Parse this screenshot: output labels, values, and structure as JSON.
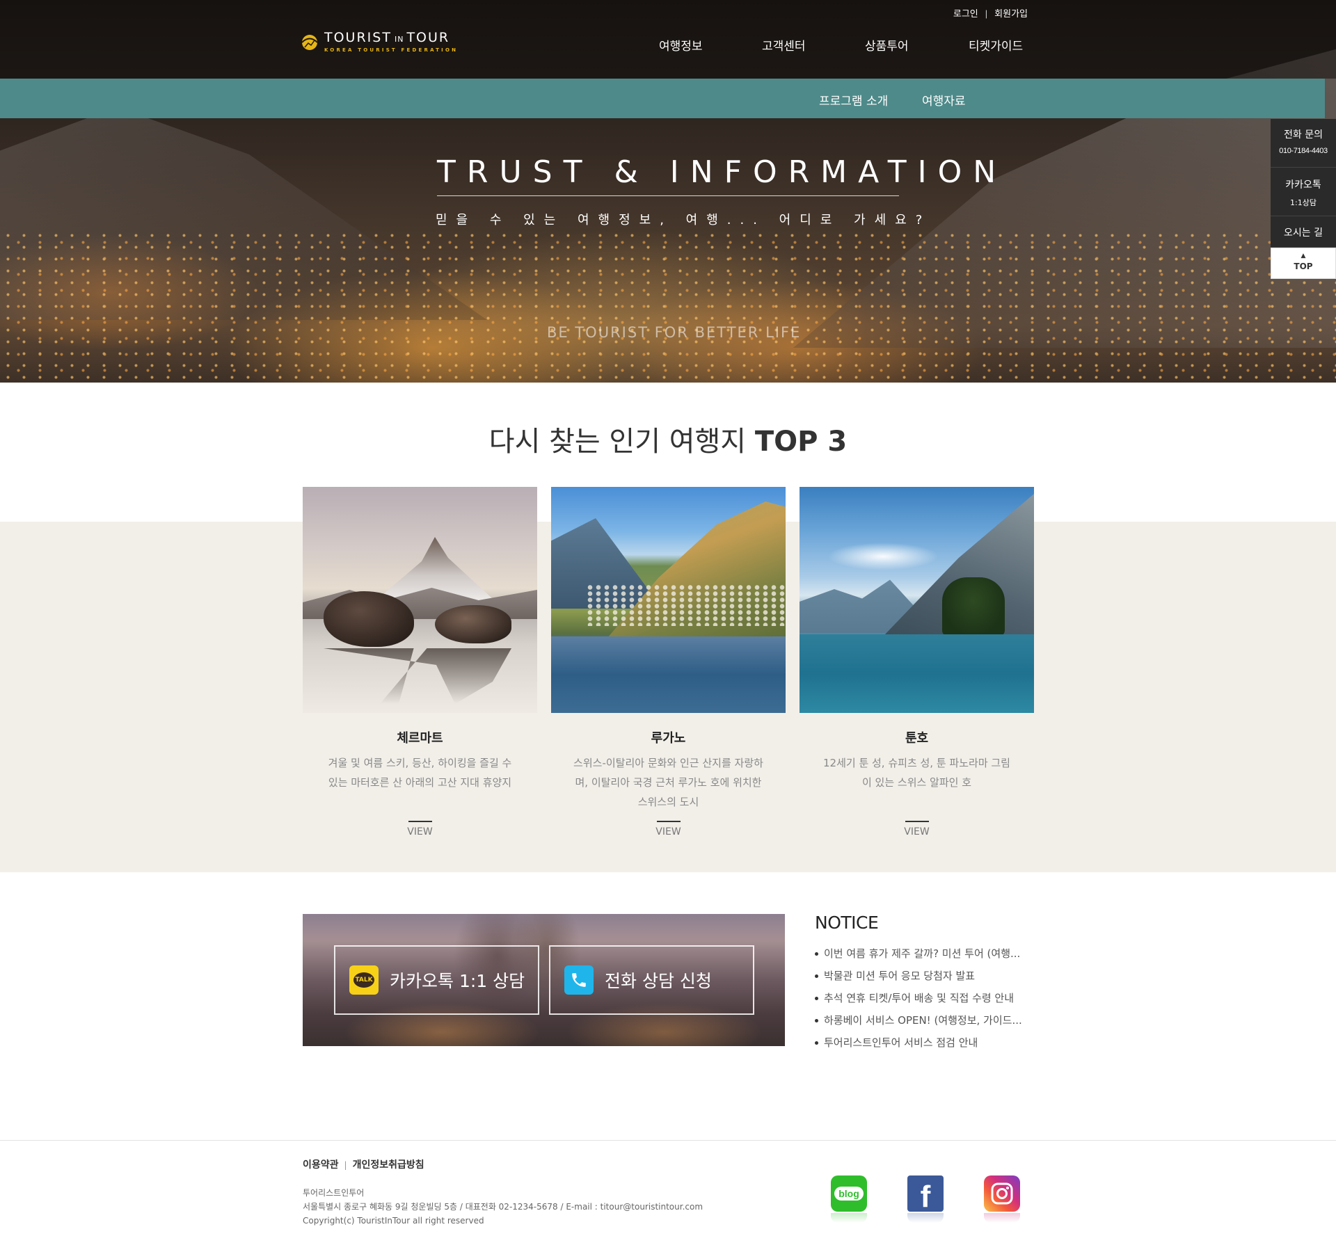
{
  "brand": {
    "logo_main": "TOURIST",
    "logo_in": "IN",
    "logo_tour": "TOUR",
    "logo_sub": "KOREA TOURIST FEDERATION",
    "accent": "#e7b515"
  },
  "util_nav": {
    "login": "로그인",
    "signup": "회원가입",
    "separator": "|"
  },
  "main_nav": [
    "여행정보",
    "고객센터",
    "상품투어",
    "티켓가이드"
  ],
  "sub_nav": [
    "프로그램 소개",
    "여행자료"
  ],
  "colors": {
    "sub_nav_bg": "#4e8a89",
    "beige_bg": "#f2efe9",
    "quick_bg": "#2a2a2a"
  },
  "hero": {
    "title": "TRUST & INFORMATION",
    "subtitle": "믿을 수 있는 여행정보, 여행... 어디로 가세요?",
    "tagline": "BE TOURIST FOR BETTER LIFE"
  },
  "quick_menu": {
    "phone_label": "전화 문의",
    "phone_number": "010-7184-4403",
    "kakao_label": "카카오톡",
    "kakao_sub": "1:1상담",
    "directions": "오시는 길",
    "top_arrow": "▲",
    "top": "TOP"
  },
  "top3": {
    "title_light": "다시 찾는 인기 여행지",
    "title_bold": "TOP 3",
    "cards": [
      {
        "name": "체르마트",
        "desc": "겨울 및 여름 스키, 등산, 하이킹을 즐길 수 있는 마터호른 산 아래의 고산 지대 휴양지",
        "view": "VIEW"
      },
      {
        "name": "루가노",
        "desc": "스위스-이탈리아 문화와 인근 산지를 자랑하며, 이탈리아 국경 근처 루가노 호에 위치한 스위스의 도시",
        "view": "VIEW"
      },
      {
        "name": "툰호",
        "desc": "12세기 툰 성, 슈피츠 성, 툰 파노라마 그림이 있는 스위스 알파인 호",
        "view": "VIEW"
      }
    ]
  },
  "consult": {
    "kakao_icon_text": "TALK",
    "kakao": "카카오톡 1:1 상담",
    "phone": "전화 상담 신청"
  },
  "notice": {
    "title": "NOTICE",
    "items": [
      "이번 여름 휴가 제주 갈까? 미션 투어 (여행...",
      "박물관 미션 투어 응모 당첨자 발표",
      "추석 연휴 티켓/투어 배송 및 직접 수령 안내",
      "하롱베이 서비스 OPEN! (여행정보, 가이드...",
      "투어리스트인투어 서비스 점검 안내"
    ]
  },
  "footer": {
    "terms": "이용약관",
    "privacy": "개인정보취급방침",
    "separator": "|",
    "company": "투어리스트인투어",
    "address": "서울특별시 종로구 혜화동 9길 청운빌딩 5층 / 대표전화 02-1234-5678 / E-mail : titour@touristintour.com",
    "copyright": "Copyright(c) TouristInTour all right reserved",
    "blog_icon_text": "blog",
    "facebook_icon_text": "f"
  }
}
